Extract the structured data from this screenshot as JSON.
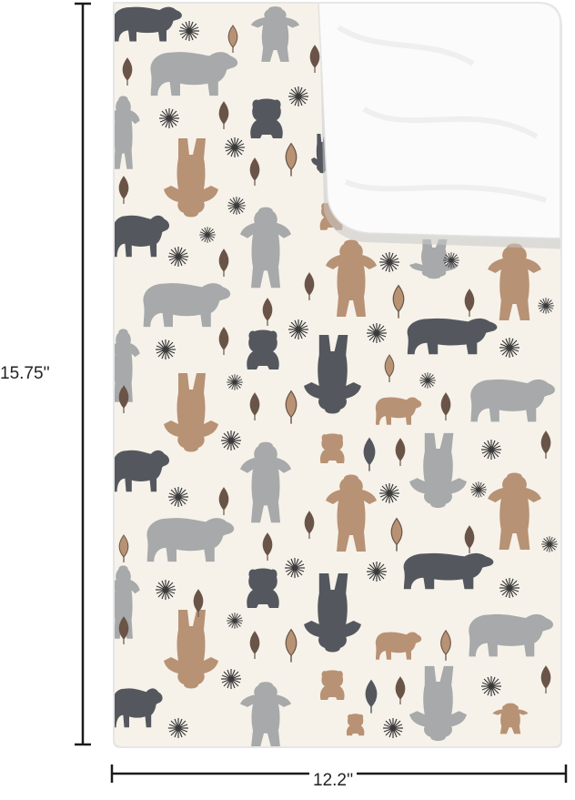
{
  "dimensions": {
    "height_label": "15.75''",
    "width_label": "12.2''"
  },
  "product": {
    "pattern": "bears-and-sparkles",
    "colors": {
      "background": "#f6f2ea",
      "dark_bear": "#54585e",
      "gray_bear": "#a7a9aa",
      "tan_bear": "#b89274",
      "border": "#e4e4e4",
      "terry_backing": "#fbfbfb",
      "dimension_line": "#1a1a1a"
    }
  }
}
